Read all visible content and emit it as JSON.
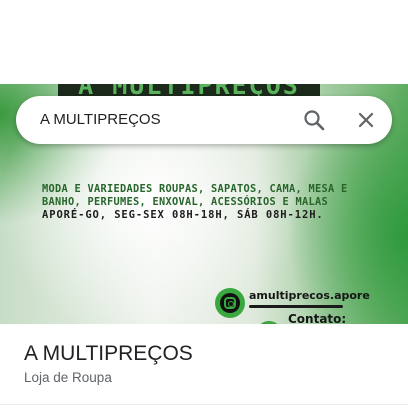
{
  "photo": {
    "banner_text": "A MULTIPREÇOS",
    "promo_lines": [
      "MODA E VARIEDADES ROUPAS, SAPATOS, CAMA, MESA E",
      "BANHO, PERFUMES, ENXOVAL, ACESSÓRIOS E MALAS"
    ],
    "hours_line": "APORÉ-GO, SEG-SEX 08H-18H, SÁB 08H-12H.",
    "instagram_handle": "amultiprecos.apore",
    "contact_label": "Contato:",
    "icons": [
      "instagram-icon"
    ],
    "colors": {
      "brand_green": "#39a83f",
      "text_green": "#27652b"
    }
  },
  "search": {
    "query": "A MULTIPREÇOS",
    "icons": [
      "search-icon",
      "close-icon"
    ]
  },
  "place": {
    "name": "A MULTIPREÇOS",
    "category": "Loja de Roupa"
  }
}
